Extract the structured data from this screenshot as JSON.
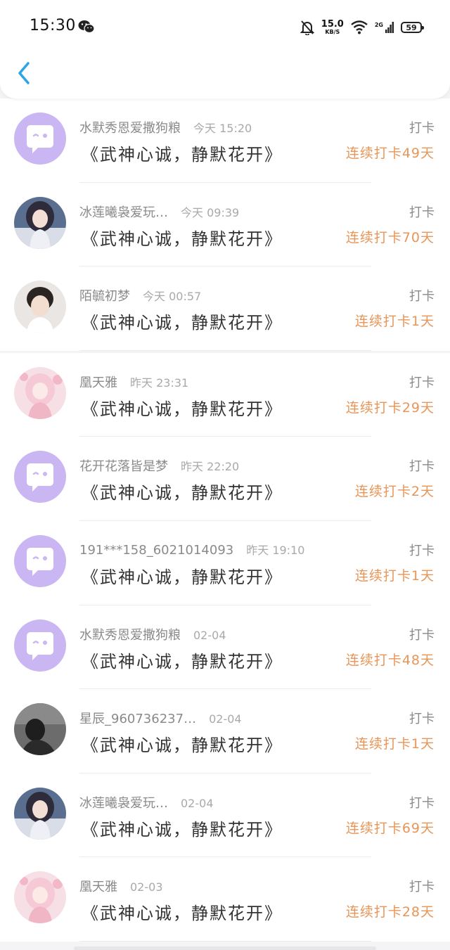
{
  "status_bar": {
    "time": "15:30",
    "net_speed": "15.0",
    "net_speed_unit": "KB/S",
    "network_type": "2G",
    "battery": "59"
  },
  "colors": {
    "accent_blue": "#2aa6e6",
    "streak_orange": "#e99557",
    "avatar_purple": "#c9b6f2"
  },
  "checkins": [
    {
      "name": "水默秀恩爱撒狗粮",
      "time": "今天 15:20",
      "book": "《武神心诚，静默花开》",
      "tag": "打卡",
      "streak": "连续打卡49天",
      "avatar": "default-purple-chat-icon"
    },
    {
      "name": "冰莲曦袅爱玩…",
      "time": "今天 09:39",
      "book": "《武神心诚，静默花开》",
      "tag": "打卡",
      "streak": "连续打卡70天",
      "avatar": "anime-girl-photo"
    },
    {
      "name": "陌毓初梦",
      "time": "今天 00:57",
      "book": "《武神心诚，静默花开》",
      "tag": "打卡",
      "streak": "连续打卡1天",
      "avatar": "boy-portrait-photo"
    },
    {
      "name": "凰天雅",
      "time": "昨天 23:31",
      "book": "《武神心诚，静默花开》",
      "tag": "打卡",
      "streak": "连续打卡29天",
      "avatar": "pink-anime-girl-photo"
    },
    {
      "name": "花开花落皆是梦",
      "time": "昨天 22:20",
      "book": "《武神心诚，静默花开》",
      "tag": "打卡",
      "streak": "连续打卡2天",
      "avatar": "default-purple-chat-icon"
    },
    {
      "name": "191***158_6021014093",
      "time": "昨天 19:10",
      "book": "《武神心诚，静默花开》",
      "tag": "打卡",
      "streak": "连续打卡1天",
      "avatar": "default-purple-chat-icon"
    },
    {
      "name": "水默秀恩爱撒狗粮",
      "time": "02-04",
      "book": "《武神心诚，静默花开》",
      "tag": "打卡",
      "streak": "连续打卡48天",
      "avatar": "default-purple-chat-icon"
    },
    {
      "name": "星辰_960736237…",
      "time": "02-04",
      "book": "《武神心诚，静默花开》",
      "tag": "打卡",
      "streak": "连续打卡1天",
      "avatar": "grayscale-person-photo"
    },
    {
      "name": "冰莲曦袅爱玩…",
      "time": "02-04",
      "book": "《武神心诚，静默花开》",
      "tag": "打卡",
      "streak": "连续打卡69天",
      "avatar": "anime-girl-photo"
    },
    {
      "name": "凰天雅",
      "time": "02-03",
      "book": "《武神心诚，静默花开》",
      "tag": "打卡",
      "streak": "连续打卡28天",
      "avatar": "pink-anime-girl-photo"
    }
  ]
}
